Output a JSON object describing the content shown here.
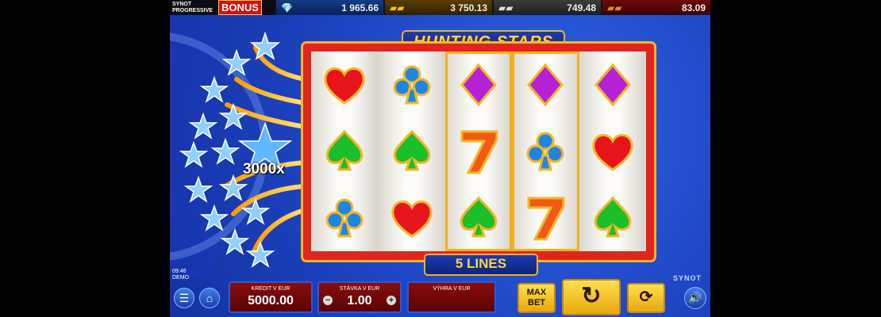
{
  "topbar": {
    "brand_line1": "SYNOT",
    "brand_line2": "PROGRESSIVE",
    "bonus_label": "BONUS",
    "jackpots": [
      {
        "icon": "diamond-icon",
        "value": "1 965.66"
      },
      {
        "icon": "gold-bars-icon",
        "value": "3 750.13"
      },
      {
        "icon": "silver-bars-icon",
        "value": "749.48"
      },
      {
        "icon": "bronze-bars-icon",
        "value": "83.09"
      }
    ]
  },
  "game": {
    "title": "HUNTING STARS",
    "multiplier": "3000x",
    "lines_label": "5 LINES",
    "reels": [
      [
        "heart",
        "spade",
        "club"
      ],
      [
        "club",
        "spade",
        "heart"
      ],
      [
        "diamond",
        "seven",
        "spade"
      ],
      [
        "diamond",
        "club",
        "seven"
      ],
      [
        "diamond",
        "heart",
        "spade"
      ]
    ],
    "highlighted_reels": [
      2,
      3
    ]
  },
  "footer": {
    "time": "09:46",
    "mode": "DEMO",
    "brand": "SYNOT",
    "credit_label": "KREDIT V EUR",
    "credit_value": "5000.00",
    "bet_label": "STÁVKA V EUR",
    "bet_value": "1.00",
    "minus": "−",
    "plus": "+",
    "win_label": "VÝHRA V EUR",
    "win_value": "",
    "max_bet_line1": "MAX",
    "max_bet_line2": "BET"
  },
  "colors": {
    "background_blue": "#1d43c0",
    "frame_red": "#e0261c",
    "gold": "#f2b21c"
  }
}
